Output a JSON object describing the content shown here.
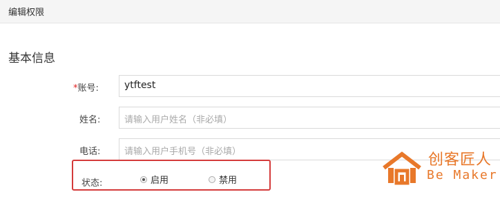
{
  "header": {
    "title": "编辑权限"
  },
  "section": {
    "title": "基本信息"
  },
  "form": {
    "account": {
      "required_mark": "*",
      "label": "账号:",
      "value": "ytftest"
    },
    "name": {
      "label": "姓名:",
      "placeholder": "请输入用户姓名（非必填）"
    },
    "phone": {
      "label": "电话:",
      "placeholder": "请输入用户手机号（非必填）"
    },
    "status": {
      "label": "状态:",
      "options": [
        "启用",
        "禁用"
      ],
      "selected": "启用"
    }
  },
  "watermark": {
    "cn": "创客匠人",
    "en": "Be Maker",
    "color": "#e8782a"
  },
  "colors": {
    "highlight": "#d43a3a",
    "required": "#e02020"
  }
}
